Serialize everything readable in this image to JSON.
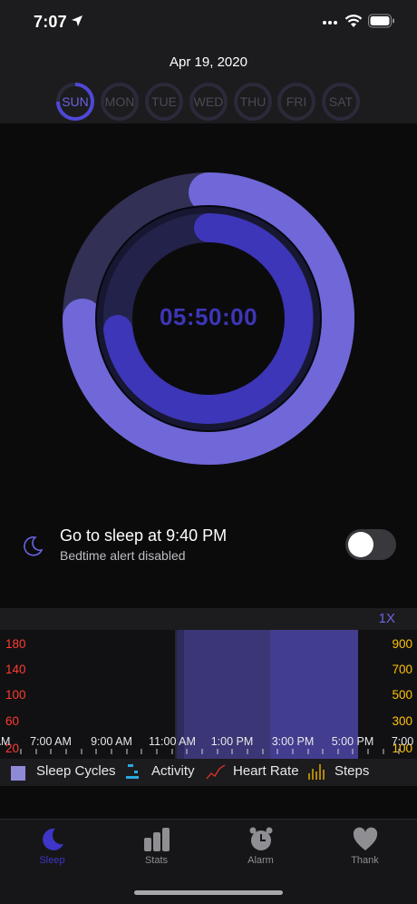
{
  "status_bar": {
    "time": "7:07"
  },
  "header": {
    "date": "Apr 19, 2020"
  },
  "days": [
    {
      "label": "SUN",
      "active": true
    },
    {
      "label": "MON",
      "active": false
    },
    {
      "label": "TUE",
      "active": false
    },
    {
      "label": "WED",
      "active": false
    },
    {
      "label": "THU",
      "active": false
    },
    {
      "label": "FRI",
      "active": false
    },
    {
      "label": "SAT",
      "active": false
    }
  ],
  "sleep_ring": {
    "duration": "05:50:00"
  },
  "bedtime": {
    "title": "Go to sleep at 9:40 PM",
    "subtitle": "Bedtime alert disabled",
    "toggle_on": false
  },
  "chart": {
    "zoom": "1X",
    "left_axis": [
      "180",
      "140",
      "100",
      "60",
      "20"
    ],
    "right_axis": [
      "900",
      "700",
      "500",
      "300",
      "100"
    ],
    "x_labels": [
      "7:00 AM",
      "9:00 AM",
      "11:00 AM",
      "1:00 PM",
      "3:00 PM",
      "5:00 PM",
      "7:00"
    ],
    "x_edge_label": "AM",
    "legend": [
      "Sleep Cycles",
      "Activity",
      "Heart Rate",
      "Steps"
    ]
  },
  "tabs": [
    {
      "label": "Sleep",
      "icon": "moon-icon",
      "active": true
    },
    {
      "label": "Stats",
      "icon": "bar-chart-icon",
      "active": false
    },
    {
      "label": "Alarm",
      "icon": "alarm-clock-icon",
      "active": false
    },
    {
      "label": "Thank",
      "icon": "heart-icon",
      "active": false
    }
  ],
  "colors": {
    "accent": "#6a63e0",
    "ring_outer": "#7068d8",
    "ring_inner": "#3d36b8",
    "axis_left": "#ff3b30",
    "axis_right": "#ffc107"
  }
}
